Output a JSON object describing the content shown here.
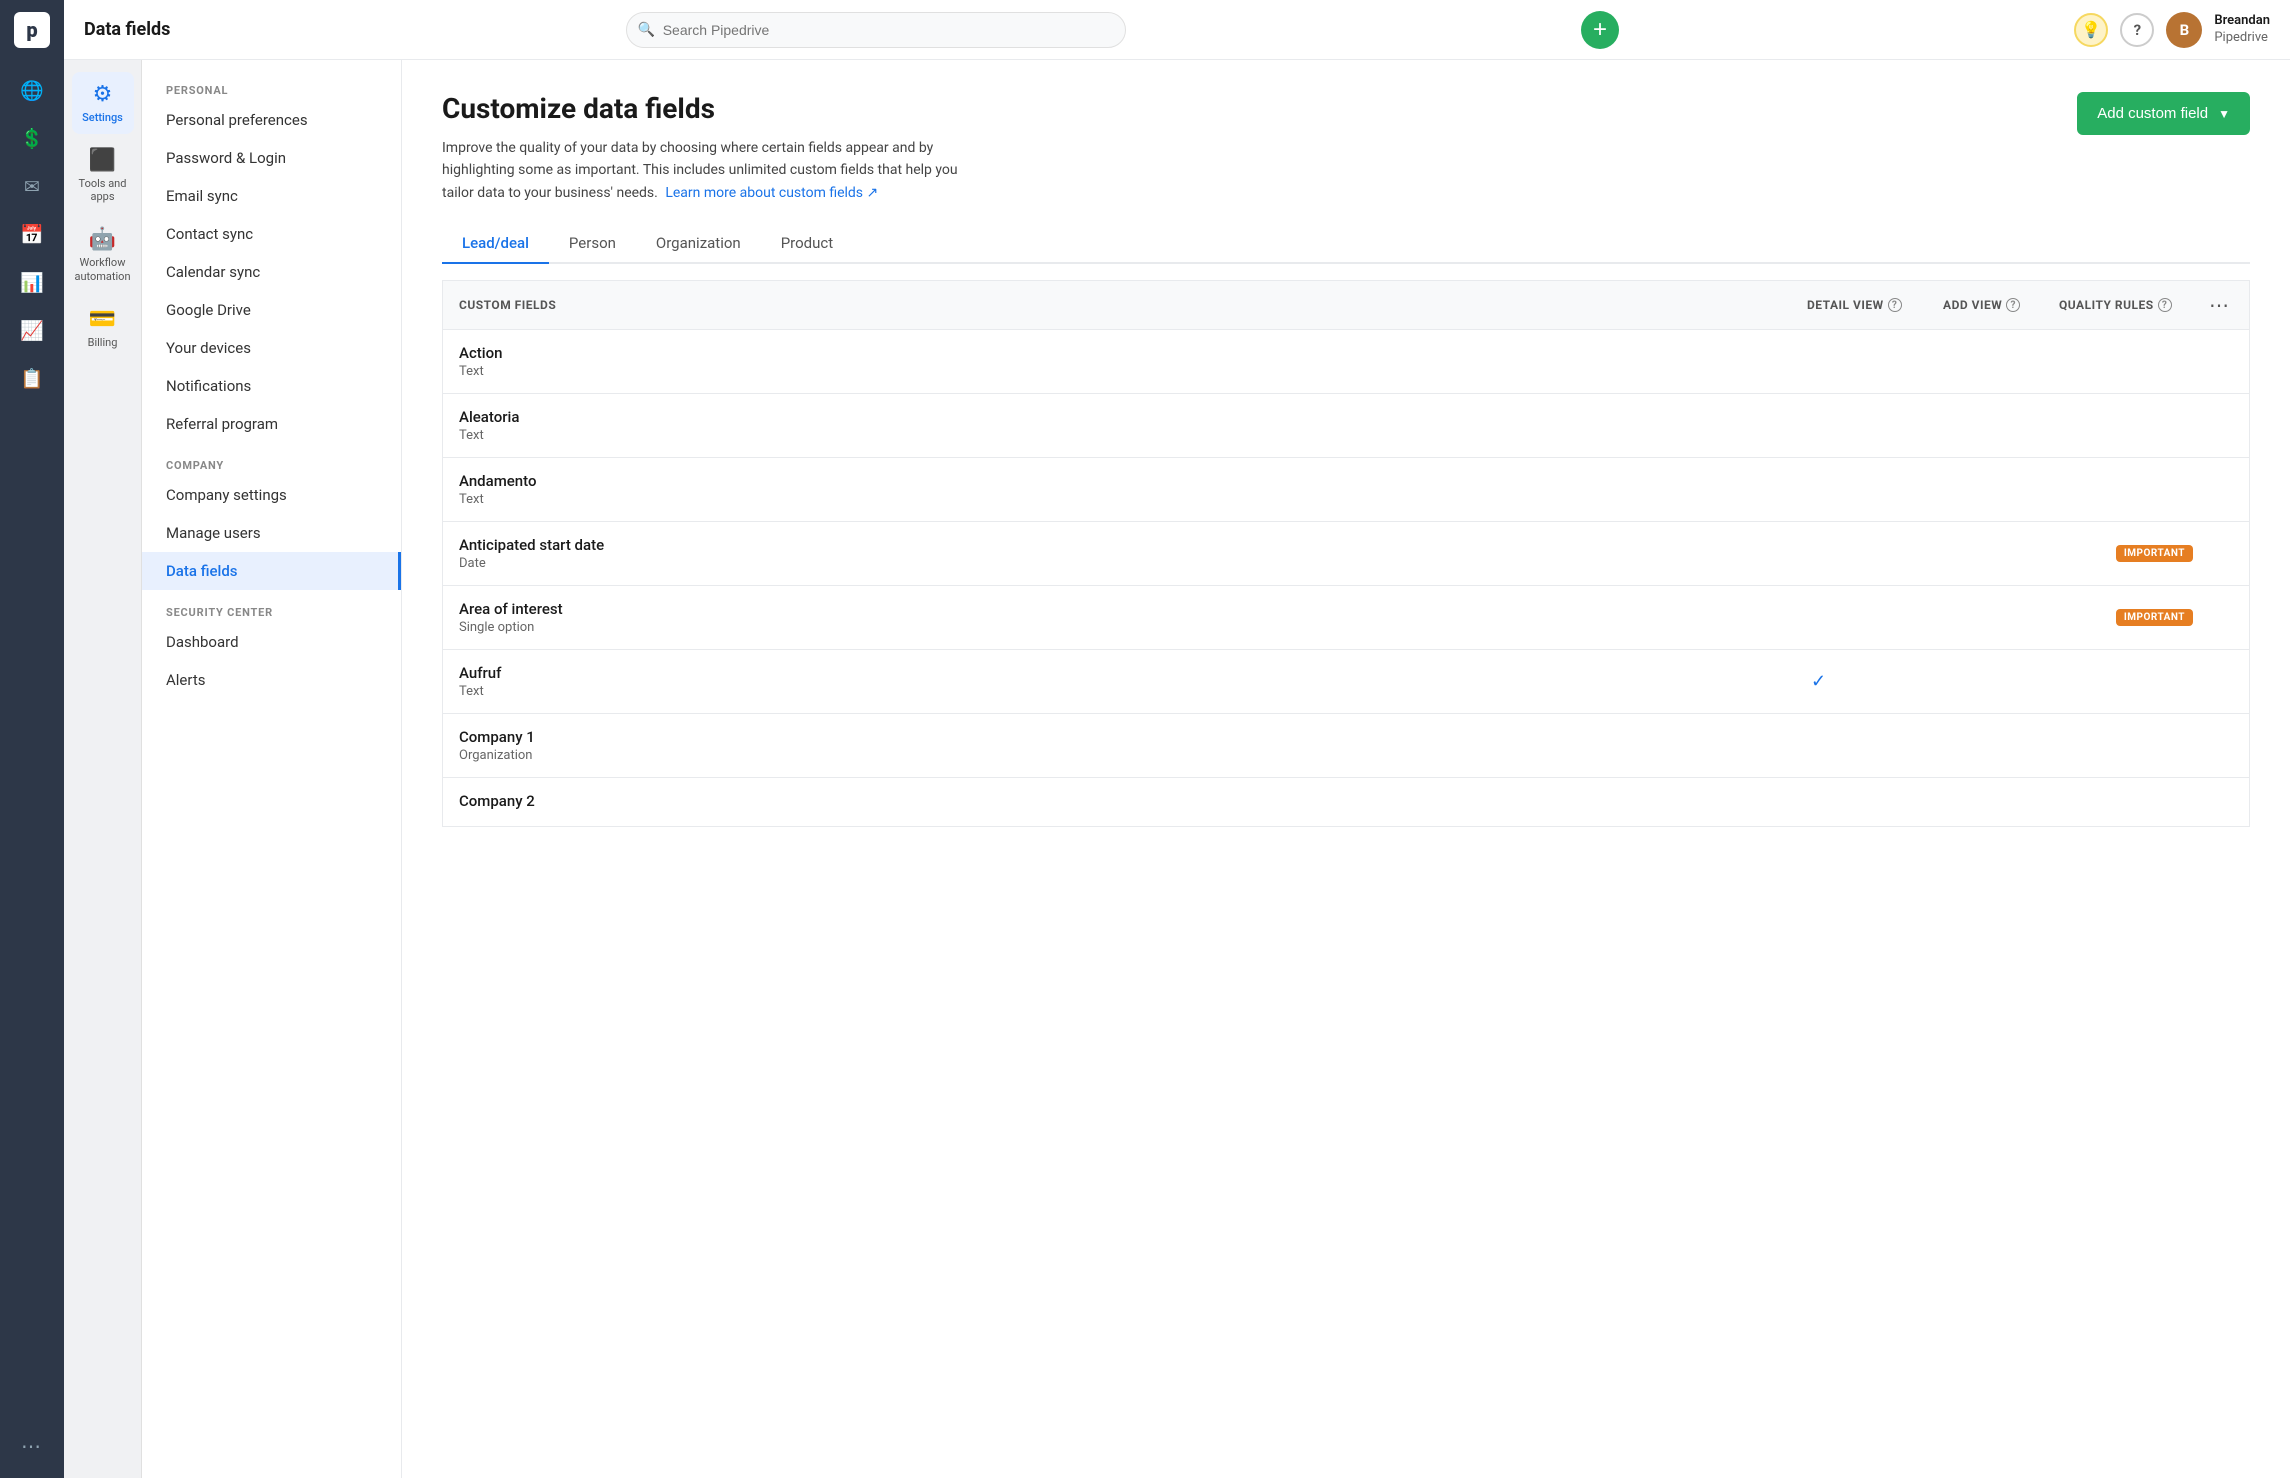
{
  "app": {
    "title": "Data fields",
    "search_placeholder": "Search Pipedrive"
  },
  "topbar": {
    "add_btn_label": "+",
    "user": {
      "name": "Breandan",
      "company": "Pipedrive",
      "initials": "B"
    },
    "bulb_icon": "💡",
    "help_icon": "?"
  },
  "left_nav": {
    "items": [
      {
        "id": "globe",
        "icon": "🌐",
        "label": ""
      },
      {
        "id": "dollar",
        "icon": "$",
        "label": ""
      },
      {
        "id": "mail",
        "icon": "✉",
        "label": ""
      },
      {
        "id": "calendar",
        "icon": "📅",
        "label": ""
      },
      {
        "id": "chart",
        "icon": "📊",
        "label": ""
      },
      {
        "id": "trending",
        "icon": "📈",
        "label": ""
      },
      {
        "id": "files",
        "icon": "📋",
        "label": ""
      }
    ],
    "dots": "..."
  },
  "settings_sidebar": {
    "items": [
      {
        "id": "settings",
        "icon": "⚙",
        "label": "Settings",
        "active": true
      },
      {
        "id": "tools",
        "icon": "🔧",
        "label": "Tools and apps",
        "active": false
      },
      {
        "id": "workflow",
        "icon": "🤖",
        "label": "Workflow automation",
        "active": false
      },
      {
        "id": "billing",
        "icon": "💳",
        "label": "Billing",
        "active": false
      }
    ]
  },
  "settings_nav": {
    "sections": [
      {
        "title": "PERSONAL",
        "items": [
          {
            "id": "personal-preferences",
            "label": "Personal preferences",
            "active": false
          },
          {
            "id": "password-login",
            "label": "Password & Login",
            "active": false
          },
          {
            "id": "email-sync",
            "label": "Email sync",
            "active": false
          },
          {
            "id": "contact-sync",
            "label": "Contact sync",
            "active": false
          },
          {
            "id": "calendar-sync",
            "label": "Calendar sync",
            "active": false
          },
          {
            "id": "google-drive",
            "label": "Google Drive",
            "active": false
          },
          {
            "id": "your-devices",
            "label": "Your devices",
            "active": false
          },
          {
            "id": "notifications",
            "label": "Notifications",
            "active": false
          },
          {
            "id": "referral-program",
            "label": "Referral program",
            "active": false
          }
        ]
      },
      {
        "title": "COMPANY",
        "items": [
          {
            "id": "company-settings",
            "label": "Company settings",
            "active": false
          },
          {
            "id": "manage-users",
            "label": "Manage users",
            "active": false
          },
          {
            "id": "data-fields",
            "label": "Data fields",
            "active": true
          }
        ]
      },
      {
        "title": "SECURITY CENTER",
        "items": [
          {
            "id": "dashboard",
            "label": "Dashboard",
            "active": false
          },
          {
            "id": "alerts",
            "label": "Alerts",
            "active": false
          }
        ]
      }
    ]
  },
  "main": {
    "page_title": "Customize data fields",
    "page_desc": "Improve the quality of your data by choosing where certain fields appear and by highlighting some as important. This includes unlimited custom fields that help you tailor data to your business' needs.",
    "learn_more_link": "Learn more about custom fields ↗",
    "add_custom_field_btn": "Add custom field",
    "tabs": [
      {
        "id": "lead-deal",
        "label": "Lead/deal",
        "active": true
      },
      {
        "id": "person",
        "label": "Person",
        "active": false
      },
      {
        "id": "organization",
        "label": "Organization",
        "active": false
      },
      {
        "id": "product",
        "label": "Product",
        "active": false
      }
    ],
    "table_headers": {
      "custom_fields": "CUSTOM FIELDS",
      "detail_view": "DETAIL VIEW",
      "add_view": "ADD VIEW",
      "quality_rules": "QUALITY RULES"
    },
    "fields": [
      {
        "id": "action",
        "name": "Action",
        "type": "Text",
        "check": false,
        "badge": null
      },
      {
        "id": "aleatoria",
        "name": "Aleatoria",
        "type": "Text",
        "check": false,
        "badge": null
      },
      {
        "id": "andamento",
        "name": "Andamento",
        "type": "Text",
        "check": false,
        "badge": null
      },
      {
        "id": "anticipated-start-date",
        "name": "Anticipated start date",
        "type": "Date",
        "check": false,
        "badge": "IMPORTANT"
      },
      {
        "id": "area-of-interest",
        "name": "Area of interest",
        "type": "Single option",
        "check": false,
        "badge": "IMPORTANT"
      },
      {
        "id": "aufruf",
        "name": "Aufruf",
        "type": "Text",
        "check": true,
        "badge": null
      },
      {
        "id": "company-1",
        "name": "Company 1",
        "type": "Organization",
        "check": false,
        "badge": null
      },
      {
        "id": "company-2",
        "name": "Company 2",
        "type": "",
        "check": false,
        "badge": null
      }
    ]
  }
}
